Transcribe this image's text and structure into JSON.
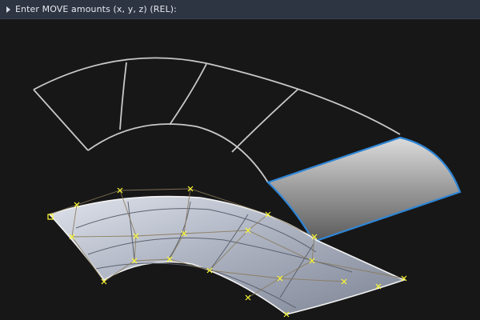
{
  "command_prompt": {
    "text": "Enter MOVE amounts (x, y, z) (REL):",
    "icon": "expand-arrow-icon"
  },
  "viewport": {
    "background": "#171717",
    "wireframe_color": "#c8c8c8",
    "selected_edge_color": "#2f86d6",
    "control_point_color": "#ffff33",
    "surface_light": "#c7ccd8",
    "surface_dark": "#7f8696"
  }
}
